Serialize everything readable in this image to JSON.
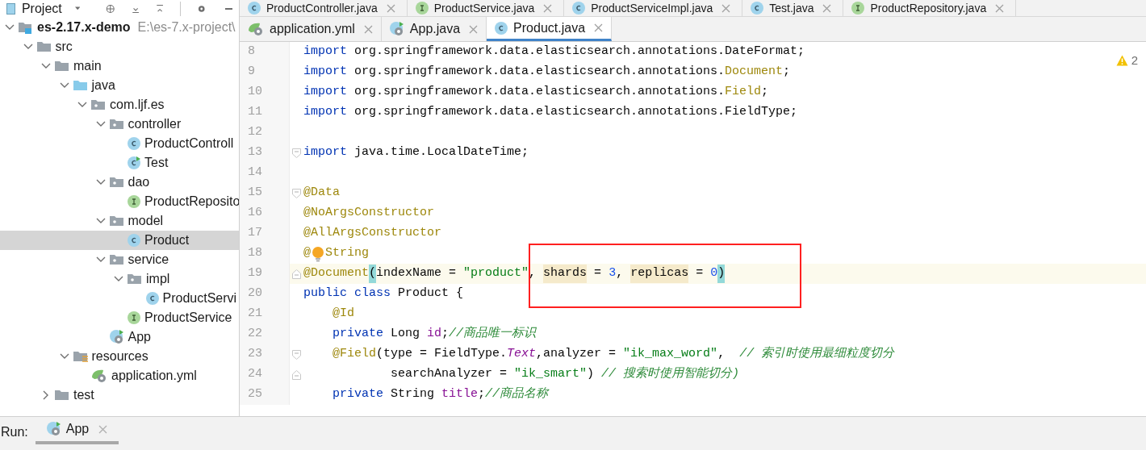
{
  "sidebar": {
    "title": "Project",
    "tree": [
      {
        "label": "es-2.17.x-demo",
        "path": "E:\\es-7.x-project\\",
        "kind": "module",
        "expanded": true,
        "selected": false,
        "children": [
          {
            "label": "src",
            "kind": "folder",
            "expanded": true,
            "selected": false,
            "children": [
              {
                "label": "main",
                "kind": "folder",
                "expanded": true,
                "selected": false,
                "children": [
                  {
                    "label": "java",
                    "kind": "source",
                    "expanded": true,
                    "selected": false,
                    "children": [
                      {
                        "label": "com.ljf.es",
                        "kind": "package",
                        "expanded": true,
                        "selected": false,
                        "children": [
                          {
                            "label": "controller",
                            "kind": "package",
                            "expanded": true,
                            "selected": false,
                            "children": [
                              {
                                "label": "ProductControll",
                                "kind": "class",
                                "selected": false
                              },
                              {
                                "label": "Test",
                                "kind": "class-run",
                                "selected": false
                              }
                            ]
                          },
                          {
                            "label": "dao",
                            "kind": "package",
                            "expanded": true,
                            "selected": false,
                            "children": [
                              {
                                "label": "ProductReposito",
                                "kind": "interface",
                                "selected": false
                              }
                            ]
                          },
                          {
                            "label": "model",
                            "kind": "package",
                            "expanded": true,
                            "selected": false,
                            "children": [
                              {
                                "label": "Product",
                                "kind": "class",
                                "selected": true
                              }
                            ]
                          },
                          {
                            "label": "service",
                            "kind": "package",
                            "expanded": true,
                            "selected": false,
                            "children": [
                              {
                                "label": "impl",
                                "kind": "package",
                                "expanded": true,
                                "selected": false,
                                "children": [
                                  {
                                    "label": "ProductServi",
                                    "kind": "class",
                                    "selected": false
                                  }
                                ]
                              },
                              {
                                "label": "ProductService",
                                "kind": "interface",
                                "selected": false
                              }
                            ]
                          },
                          {
                            "label": "App",
                            "kind": "app",
                            "selected": false
                          }
                        ]
                      }
                    ]
                  },
                  {
                    "label": "resources",
                    "kind": "resources",
                    "expanded": true,
                    "selected": false,
                    "children": [
                      {
                        "label": "application.yml",
                        "kind": "yaml",
                        "selected": false
                      }
                    ]
                  }
                ]
              },
              {
                "label": "test",
                "kind": "folder",
                "expanded": false,
                "selected": false
              }
            ]
          }
        ]
      }
    ]
  },
  "editor": {
    "tab_rows": [
      [
        {
          "label": "ProductController.java",
          "kind": "class",
          "selected": false
        },
        {
          "label": "ProductService.java",
          "kind": "interface",
          "selected": false
        },
        {
          "label": "ProductServiceImpl.java",
          "kind": "class",
          "selected": false
        },
        {
          "label": "Test.java",
          "kind": "class",
          "selected": false
        },
        {
          "label": "ProductRepository.java",
          "kind": "interface",
          "selected": false
        }
      ],
      [
        {
          "label": "application.yml",
          "kind": "yaml",
          "selected": false
        },
        {
          "label": "App.java",
          "kind": "app",
          "selected": false
        },
        {
          "label": "Product.java",
          "kind": "class",
          "selected": true
        }
      ]
    ],
    "warnings": "2",
    "lines": [
      {
        "number": "8",
        "kind": "plain",
        "tokens": [
          {
            "text": "import",
            "kind": "keyword"
          },
          {
            "text": " org.springframework.data.elasticsearch.annotations.DateFormat;",
            "kind": "plain"
          }
        ]
      },
      {
        "number": "9",
        "kind": "plain",
        "tokens": [
          {
            "text": "import",
            "kind": "keyword"
          },
          {
            "text": " org.springframework.data.elasticsearch.annotations.",
            "kind": "plain"
          },
          {
            "text": "Document",
            "kind": "annotation"
          },
          {
            "text": ";",
            "kind": "plain"
          }
        ]
      },
      {
        "number": "10",
        "kind": "plain",
        "tokens": [
          {
            "text": "import",
            "kind": "keyword"
          },
          {
            "text": " org.springframework.data.elasticsearch.annotations.",
            "kind": "plain"
          },
          {
            "text": "Field",
            "kind": "annotation"
          },
          {
            "text": ";",
            "kind": "plain"
          }
        ]
      },
      {
        "number": "11",
        "kind": "plain",
        "tokens": [
          {
            "text": "import",
            "kind": "keyword"
          },
          {
            "text": " org.springframework.data.elasticsearch.annotations.FieldType;",
            "kind": "plain"
          }
        ]
      },
      {
        "number": "12",
        "kind": "plain"
      },
      {
        "number": "13",
        "kind": "fold-start",
        "tokens": [
          {
            "text": "import",
            "kind": "keyword"
          },
          {
            "text": " java.time.LocalDateTime;",
            "kind": "plain"
          }
        ]
      },
      {
        "number": "14",
        "kind": "plain"
      },
      {
        "number": "15",
        "kind": "fold-start",
        "tokens": [
          {
            "text": "@Data",
            "kind": "annotation"
          }
        ]
      },
      {
        "number": "16",
        "kind": "plain",
        "tokens": [
          {
            "text": "@NoArgsConstructor",
            "kind": "annotation"
          }
        ]
      },
      {
        "number": "17",
        "kind": "plain",
        "tokens": [
          {
            "text": "@AllArgsConstructor",
            "kind": "annotation"
          }
        ]
      },
      {
        "number": "18",
        "kind": "plain",
        "tokens": [
          {
            "text": "@",
            "kind": "annotation"
          },
          {
            "kind": "bulb"
          },
          {
            "text": "String",
            "kind": "annotation"
          }
        ]
      },
      {
        "number": "19",
        "kind": "fold-end",
        "current": true,
        "tokens": [
          {
            "text": "@Document",
            "kind": "annotation"
          },
          {
            "text": "(",
            "kind": "brace"
          },
          {
            "text": "indexName = ",
            "kind": "plain"
          },
          {
            "text": "\"product\"",
            "kind": "string"
          },
          {
            "text": ", ",
            "kind": "plain"
          },
          {
            "text": "shards",
            "kind": "param"
          },
          {
            "text": " = ",
            "kind": "plain"
          },
          {
            "text": "3",
            "kind": "number"
          },
          {
            "text": ", ",
            "kind": "plain"
          },
          {
            "text": "replicas",
            "kind": "param"
          },
          {
            "text": " = ",
            "kind": "plain"
          },
          {
            "text": "0",
            "kind": "number"
          },
          {
            "text": ")",
            "kind": "brace"
          }
        ]
      },
      {
        "number": "20",
        "kind": "plain",
        "tokens": [
          {
            "text": "public class",
            "kind": "keyword"
          },
          {
            "text": " Product {",
            "kind": "plain"
          }
        ]
      },
      {
        "number": "21",
        "kind": "plain",
        "tokens": [
          {
            "text": "    @Id",
            "kind": "annotation"
          }
        ]
      },
      {
        "number": "22",
        "kind": "plain",
        "tokens": [
          {
            "text": "    private",
            "kind": "keyword"
          },
          {
            "text": " Long ",
            "kind": "plain"
          },
          {
            "text": "id",
            "kind": "field"
          },
          {
            "text": ";",
            "kind": "plain"
          },
          {
            "text": "//商品唯一标识",
            "kind": "comment"
          }
        ]
      },
      {
        "number": "23",
        "kind": "fold-start",
        "tokens": [
          {
            "text": "    @Field",
            "kind": "annotation"
          },
          {
            "text": "(type = FieldType.",
            "kind": "plain"
          },
          {
            "text": "Text",
            "kind": "static"
          },
          {
            "text": ",analyzer = ",
            "kind": "plain"
          },
          {
            "text": "\"ik_max_word\"",
            "kind": "string"
          },
          {
            "text": ",  ",
            "kind": "plain"
          },
          {
            "text": "// 索引时使用最细粒度切分",
            "kind": "comment"
          }
        ]
      },
      {
        "number": "24",
        "kind": "fold-end",
        "tokens": [
          {
            "text": "            searchAnalyzer = ",
            "kind": "plain"
          },
          {
            "text": "\"ik_smart\"",
            "kind": "string"
          },
          {
            "text": ") ",
            "kind": "plain"
          },
          {
            "text": "// 搜索时使用智能切分)",
            "kind": "comment"
          }
        ]
      },
      {
        "number": "25",
        "kind": "plain",
        "tokens": [
          {
            "text": "    private",
            "kind": "keyword"
          },
          {
            "text": " String ",
            "kind": "plain"
          },
          {
            "text": "title",
            "kind": "field"
          },
          {
            "text": ";",
            "kind": "plain"
          },
          {
            "text": "//商品名称",
            "kind": "comment"
          }
        ]
      }
    ]
  },
  "run_bar": {
    "label": "Run:",
    "tabs": [
      {
        "label": "App",
        "kind": "app",
        "selected": true
      }
    ]
  }
}
